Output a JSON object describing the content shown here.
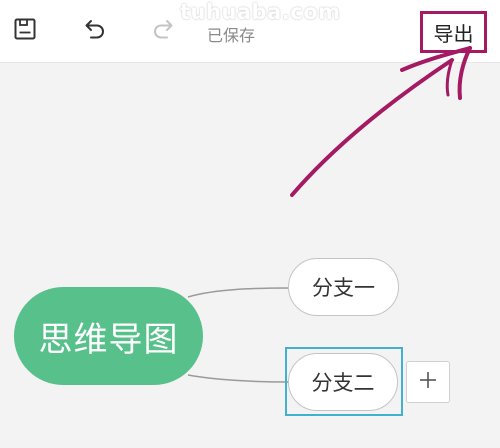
{
  "toolbar": {
    "save_icon": "save-icon",
    "undo_icon": "undo-icon",
    "redo_icon": "redo-icon",
    "status_text": "已保存",
    "export_label": "导出"
  },
  "watermark": "tuhuaba.com",
  "mindmap": {
    "root_label": "思维导图",
    "branches": [
      {
        "label": "分支一",
        "selected": false
      },
      {
        "label": "分支二",
        "selected": true
      }
    ],
    "add_child_icon": "plus-icon"
  },
  "colors": {
    "root_fill": "#57c08b",
    "selection": "#41b1cf",
    "annotation": "#a41a63"
  }
}
